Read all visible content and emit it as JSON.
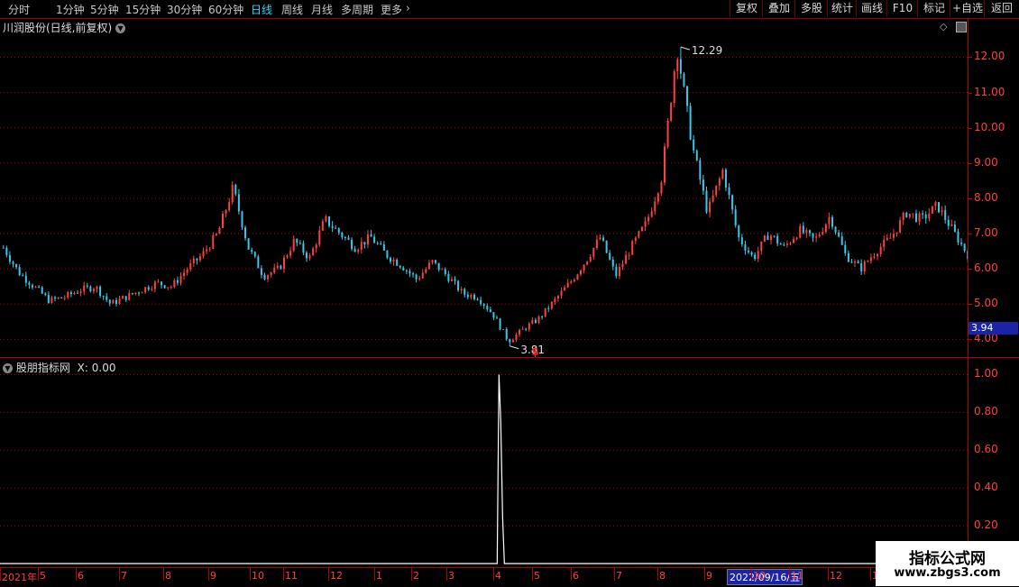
{
  "toolbar": {
    "periods": [
      "分时",
      "1分钟",
      "5分钟",
      "15分钟",
      "30分钟",
      "60分钟",
      "日线",
      "周线",
      "月线",
      "多周期",
      "更多"
    ],
    "active_period": "日线",
    "more_icon": "chevron-right-icon",
    "right_buttons": [
      "复权",
      "叠加",
      "多股",
      "统计",
      "画线",
      "F10",
      "标记",
      "+自选",
      "返回"
    ]
  },
  "main": {
    "title": "川润股份(日线,前复权)",
    "dropdown_icon": "chevron-down-icon",
    "corner_icons": [
      "diamond-icon",
      "panel-toggle-icon"
    ],
    "high_label": "12.29",
    "low_label": "3.81",
    "signal_marker": "$",
    "price_tag": "3.94",
    "y_ticks": [
      "12.00",
      "11.00",
      "10.00",
      "9.00",
      "8.00",
      "7.00",
      "6.00",
      "5.00",
      "4.00"
    ]
  },
  "indicator": {
    "title": "股朋指标网",
    "value_label": "X: 0.00",
    "dropdown_icon": "chevron-down-icon",
    "y_ticks": [
      "1.00",
      "0.80",
      "0.60",
      "0.40",
      "0.20"
    ]
  },
  "xaxis": {
    "labels": [
      "2021年",
      "5",
      "6",
      "7",
      "8",
      "9",
      "10",
      "11",
      "12",
      "1",
      "2",
      "3",
      "4",
      "5",
      "6",
      "7",
      "8",
      "9",
      "10",
      "11",
      "12",
      "1"
    ],
    "crosshair_date": "2022/09/16/五"
  },
  "watermark": {
    "title": "指标公式网",
    "url": "www.zbgs3.com"
  },
  "colors": {
    "up": "#ff4040",
    "down": "#3ac8e8",
    "grid": "#b00000",
    "active": "#39d0f0",
    "highlight": "#1b23a8"
  },
  "chart_data": [
    {
      "type": "candlestick",
      "title": "川润股份(日线,前复权)",
      "ylim": [
        3.6,
        12.6
      ],
      "y_ticks": [
        12,
        11,
        10,
        9,
        8,
        7,
        6,
        5,
        4
      ],
      "x_labels": [
        "2021年",
        "5",
        "6",
        "7",
        "8",
        "9",
        "10",
        "11",
        "12",
        "1",
        "2",
        "3",
        "4",
        "5",
        "6",
        "7",
        "8",
        "9",
        "10",
        "11",
        "12",
        "1"
      ],
      "approx_close_path": [
        6.6,
        5.9,
        5.5,
        5.1,
        5.2,
        5.4,
        5.5,
        5.0,
        5.2,
        5.4,
        5.6,
        5.5,
        6.0,
        6.4,
        7.0,
        8.3,
        6.6,
        5.8,
        6.0,
        6.8,
        6.3,
        7.4,
        7.0,
        6.6,
        6.9,
        6.4,
        6.1,
        5.7,
        6.2,
        5.8,
        5.3,
        5.2,
        4.7,
        3.95,
        4.3,
        4.6,
        5.1,
        5.6,
        6.2,
        6.9,
        5.8,
        6.6,
        7.3,
        8.6,
        12.29,
        9.5,
        7.6,
        8.8,
        6.9,
        6.3,
        7.0,
        6.6,
        7.1,
        6.8,
        7.5,
        6.4,
        6.0,
        6.5,
        6.9,
        7.6,
        7.4,
        7.8,
        7.1,
        6.4
      ],
      "high": 12.29,
      "low": 3.81,
      "last": 3.94
    },
    {
      "type": "line",
      "title": "股朋指标网",
      "ylim": [
        0,
        1.05
      ],
      "y_ticks": [
        1.0,
        0.8,
        0.6,
        0.4,
        0.2
      ],
      "series": [
        {
          "values_note_spike_near_low": [
            0,
            0,
            1.0,
            0.75,
            0.25,
            0,
            0
          ]
        }
      ]
    }
  ]
}
